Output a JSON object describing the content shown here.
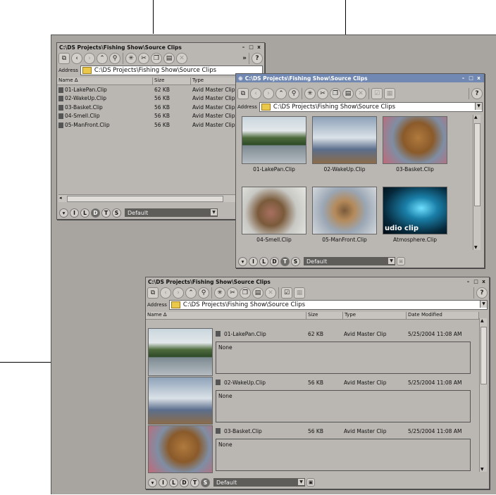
{
  "folder_path": "C:\\DS Projects\\Fishing Show\\Source Clips",
  "address_label": "Address",
  "address_value": "C:\\DS Projects\\Fishing Show\\Source Clips",
  "preset": "Default",
  "view_buttons": [
    "I",
    "L",
    "D",
    "T",
    "S"
  ],
  "columns": {
    "name": "Name ∆",
    "size": "Size",
    "type": "Type",
    "date": "Date Modified"
  },
  "details_clips": [
    {
      "name": "01-LakePan.Clip",
      "size": "62 KB",
      "type": "Avid Master Clip"
    },
    {
      "name": "02-WakeUp.Clip",
      "size": "56 KB",
      "type": "Avid Master Clip"
    },
    {
      "name": "03-Basket.Clip",
      "size": "56 KB",
      "type": "Avid Master Clip"
    },
    {
      "name": "04-Smell.Clip",
      "size": "56 KB",
      "type": "Avid Master Clip"
    },
    {
      "name": "05-ManFront.Clip",
      "size": "56 KB",
      "type": "Avid Master Clip"
    }
  ],
  "thumb_clips": [
    "01-LakePan.Clip",
    "02-WakeUp.Clip",
    "03-Basket.Clip",
    "04-Smell.Clip",
    "05-ManFront.Clip",
    "Atmosphere.Clip"
  ],
  "thumb_overlay": "udio clip",
  "list_clips": [
    {
      "name": "01-LakePan.Clip",
      "size": "62 KB",
      "type": "Avid Master Clip",
      "date": "5/25/2004 11:08 AM",
      "notes": "None"
    },
    {
      "name": "02-WakeUp.Clip",
      "size": "56 KB",
      "type": "Avid Master Clip",
      "date": "5/25/2004 11:08 AM",
      "notes": "None"
    },
    {
      "name": "03-Basket.Clip",
      "size": "56 KB",
      "type": "Avid Master Clip",
      "date": "5/25/2004 11:08 AM",
      "notes": "None"
    }
  ],
  "window_buttons": {
    "minimize": "–",
    "maximize": "□",
    "close": "x"
  },
  "toolbar_more": "»",
  "help": "?",
  "colors": {
    "panel": "#a8a5a0",
    "window": "#bab7b2",
    "active_title": "#7188b2"
  }
}
